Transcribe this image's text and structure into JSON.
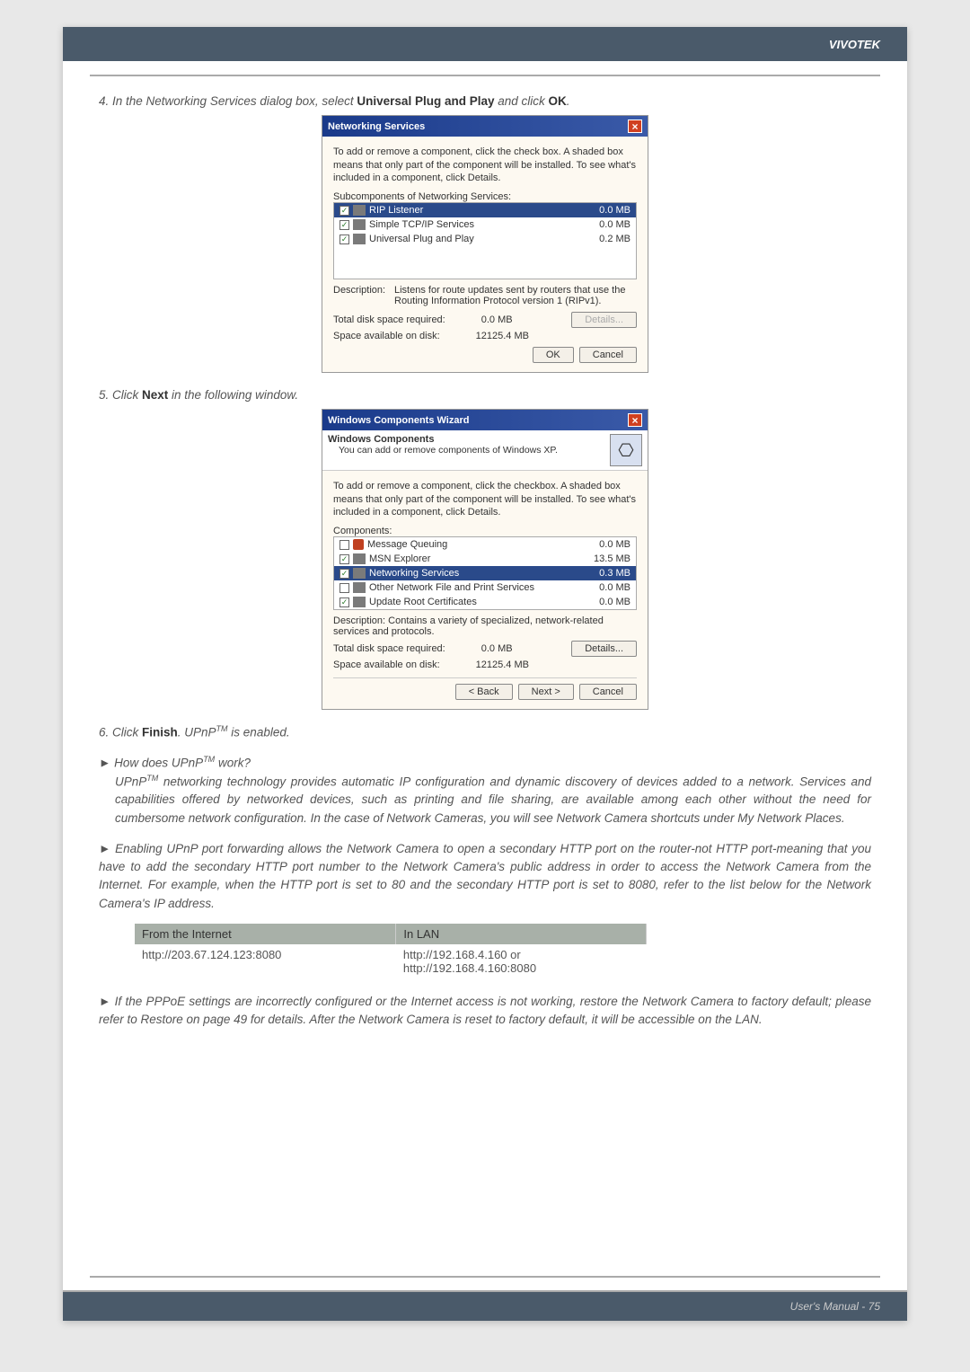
{
  "header": {
    "brand": "VIVOTEK"
  },
  "step4": {
    "prefix": "4. In the Networking Services dialog box, select ",
    "bold1": "Universal Plug and Play",
    "mid": " and click ",
    "bold2": "OK",
    "suffix": "."
  },
  "dialog1": {
    "title": "Networking Services",
    "intro": "To add or remove a component, click the check box. A shaded box means that only part of the component will be installed. To see what's included in a component, click Details.",
    "subLabel": "Subcomponents of Networking Services:",
    "rows": [
      {
        "name": "RIP Listener",
        "size": "0.0 MB",
        "selected": true
      },
      {
        "name": "Simple TCP/IP Services",
        "size": "0.0 MB",
        "selected": false
      },
      {
        "name": "Universal Plug and Play",
        "size": "0.2 MB",
        "selected": false
      }
    ],
    "descLabel": "Description:",
    "descText": "Listens for route updates sent by routers that use the Routing Information Protocol version 1 (RIPv1).",
    "reqLabel": "Total disk space required:",
    "reqVal": "0.0 MB",
    "availLabel": "Space available on disk:",
    "availVal": "12125.4 MB",
    "details": "Details...",
    "ok": "OK",
    "cancel": "Cancel"
  },
  "step5": {
    "prefix": "5. Click ",
    "bold": "Next",
    "suffix": " in the following window."
  },
  "dialog2": {
    "title": "Windows Components Wizard",
    "heading": "Windows Components",
    "sub": "You can add or remove components of Windows XP.",
    "intro": "To add or remove a component, click the checkbox. A shaded box means that only part of the component will be installed. To see what's included in a component, click Details.",
    "compLabel": "Components:",
    "rows": [
      {
        "name": "Message Queuing",
        "size": "0.0 MB",
        "checked": false
      },
      {
        "name": "MSN Explorer",
        "size": "13.5 MB",
        "checked": true
      },
      {
        "name": "Networking Services",
        "size": "0.3 MB",
        "checked": true,
        "selected": true
      },
      {
        "name": "Other Network File and Print Services",
        "size": "0.0 MB",
        "checked": false
      },
      {
        "name": "Update Root Certificates",
        "size": "0.0 MB",
        "checked": true
      }
    ],
    "descLabel": "Description:",
    "descText": "Contains a variety of specialized, network-related services and protocols.",
    "reqLabel": "Total disk space required:",
    "reqVal": "0.0 MB",
    "availLabel": "Space available on disk:",
    "availVal": "12125.4 MB",
    "details": "Details...",
    "back": "< Back",
    "next": "Next >",
    "cancel": "Cancel"
  },
  "step6": {
    "prefix": "6. Click ",
    "bold": "Finish",
    "mid": ". UPnP",
    "tm": "TM",
    "suffix": " is enabled."
  },
  "q1": {
    "arrow": "►",
    "prefix": " How does UPnP",
    "tm": "TM",
    "suffix": " work?",
    "body1": "UPnP",
    "body2": " networking technology provides automatic IP configuration and dynamic discovery of devices added to a network. Services and capabilities offered by networked devices, such as printing and file sharing, are available among each other without the need for cumbersome network configuration. In the case of Network Cameras, you will see Network Camera shortcuts under My Network Places."
  },
  "q2": {
    "arrow": "►",
    "body": " Enabling UPnP port forwarding allows the Network Camera to open a secondary HTTP port on the router-not HTTP port-meaning that you have to add the secondary HTTP port number to the Network Camera's public address in order to access the Network Camera from the Internet. For example, when the HTTP port is set to 80 and the secondary HTTP port is set to 8080, refer to the list below for the Network Camera's IP address."
  },
  "iptable": {
    "th1": "From the Internet",
    "th2": "In LAN",
    "td1": "http://203.67.124.123:8080",
    "td2a": "http://192.168.4.160 or",
    "td2b": "http://192.168.4.160:8080"
  },
  "q3": {
    "arrow": "►",
    "body": " If the PPPoE settings are incorrectly configured or the Internet access is not working, restore the Network Camera to factory default; please refer to Restore on page 49 for details. After the Network Camera is reset to factory default, it will be accessible on the LAN."
  },
  "footer": {
    "text": "User's Manual - 75"
  }
}
